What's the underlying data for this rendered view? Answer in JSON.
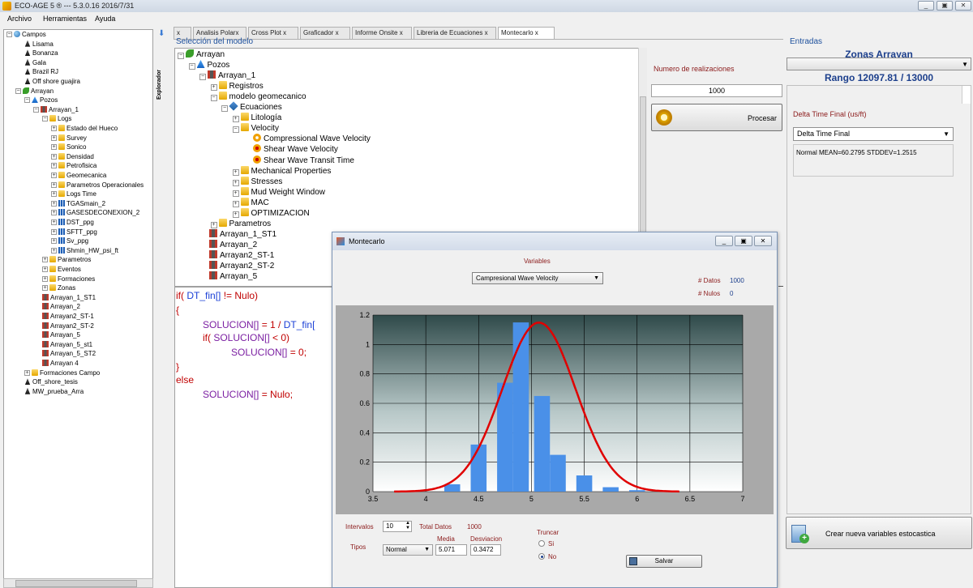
{
  "app": {
    "title": "ECO-AGE 5 ® --- 5.3.0.16     2016/7/31"
  },
  "menu": [
    "Archivo",
    "Herramientas",
    "Ayuda"
  ],
  "left_tree": [
    {
      "label": "Campos",
      "depth": 0,
      "icon": "globe",
      "toggle": "-"
    },
    {
      "label": "Lisama",
      "depth": 1,
      "icon": "rig"
    },
    {
      "label": "Bonanza",
      "depth": 1,
      "icon": "rig"
    },
    {
      "label": "Gala",
      "depth": 1,
      "icon": "rig"
    },
    {
      "label": "Brazil RJ",
      "depth": 1,
      "icon": "rig"
    },
    {
      "label": "Off shore guajira",
      "depth": 1,
      "icon": "rig"
    },
    {
      "label": "Arrayan",
      "depth": 1,
      "icon": "leaf",
      "toggle": "-"
    },
    {
      "label": "Pozos",
      "depth": 2,
      "icon": "wells",
      "toggle": "-"
    },
    {
      "label": "Arrayan_1",
      "depth": 3,
      "icon": "well",
      "toggle": "-"
    },
    {
      "label": "Logs",
      "depth": 4,
      "icon": "folder",
      "toggle": "-"
    },
    {
      "label": "Estado del Hueco",
      "depth": 5,
      "icon": "folder",
      "toggle": "+"
    },
    {
      "label": "Survey",
      "depth": 5,
      "icon": "folder",
      "toggle": "+"
    },
    {
      "label": "Sonico",
      "depth": 5,
      "icon": "folder",
      "toggle": "+"
    },
    {
      "label": "Densidad",
      "depth": 5,
      "icon": "folder",
      "toggle": "+"
    },
    {
      "label": "Petrofisica",
      "depth": 5,
      "icon": "folder",
      "toggle": "+"
    },
    {
      "label": "Geomecanica",
      "depth": 5,
      "icon": "folder",
      "toggle": "+"
    },
    {
      "label": "Parametros Operacionales",
      "depth": 5,
      "icon": "folder",
      "toggle": "+"
    },
    {
      "label": "Logs Time",
      "depth": 5,
      "icon": "folder",
      "toggle": "+"
    },
    {
      "label": "TGASmain_2",
      "depth": 5,
      "icon": "logdata",
      "toggle": "+"
    },
    {
      "label": "GASESDECONEXION_2",
      "depth": 5,
      "icon": "logdata",
      "toggle": "+"
    },
    {
      "label": "DST_ppg",
      "depth": 5,
      "icon": "logdata",
      "toggle": "+"
    },
    {
      "label": "SFTT_ppg",
      "depth": 5,
      "icon": "logdata",
      "toggle": "+"
    },
    {
      "label": "Sv_ppg",
      "depth": 5,
      "icon": "logdata",
      "toggle": "+"
    },
    {
      "label": "Shmin_HW_psi_ft",
      "depth": 5,
      "icon": "logdata",
      "toggle": "+"
    },
    {
      "label": "Parametros",
      "depth": 4,
      "icon": "folder",
      "toggle": "+"
    },
    {
      "label": "Eventos",
      "depth": 4,
      "icon": "folder",
      "toggle": "+"
    },
    {
      "label": "Formaciones",
      "depth": 4,
      "icon": "folder",
      "toggle": "+"
    },
    {
      "label": "Zonas",
      "depth": 4,
      "icon": "folder",
      "toggle": "+"
    },
    {
      "label": "Arrayan_1_ST1",
      "depth": 3,
      "icon": "well"
    },
    {
      "label": "Arrayan_2",
      "depth": 3,
      "icon": "well"
    },
    {
      "label": "Arrayan2_ST-1",
      "depth": 3,
      "icon": "well"
    },
    {
      "label": "Arrayan2_ST-2",
      "depth": 3,
      "icon": "well"
    },
    {
      "label": "Arrayan_5",
      "depth": 3,
      "icon": "well"
    },
    {
      "label": "Arrayan_5_st1",
      "depth": 3,
      "icon": "well"
    },
    {
      "label": "Arrayan_5_ST2",
      "depth": 3,
      "icon": "well"
    },
    {
      "label": "Arrayan 4",
      "depth": 3,
      "icon": "well"
    },
    {
      "label": "Formaciones Campo",
      "depth": 2,
      "icon": "folder",
      "toggle": "+"
    },
    {
      "label": "Off_shore_tesis",
      "depth": 1,
      "icon": "rig"
    },
    {
      "label": "MW_prueba_Arra",
      "depth": 1,
      "icon": "rig"
    }
  ],
  "explorer_label": "Explorador",
  "tabs": [
    {
      "label": "x"
    },
    {
      "label": "Analisis Polarx"
    },
    {
      "label": "Cross Plot x"
    },
    {
      "label": "Graficador x"
    },
    {
      "label": "Informe Onsite x"
    },
    {
      "label": "Libreria de Ecuaciones x"
    },
    {
      "label": "Montecarlo    x",
      "active": true
    }
  ],
  "selection_title": "Selección del modelo",
  "model_tree": [
    {
      "label": "Arrayan",
      "depth": 0,
      "icon": "leaf",
      "toggle": "-"
    },
    {
      "label": "Pozos",
      "depth": 1,
      "icon": "wells",
      "toggle": "-"
    },
    {
      "label": "Arrayan_1",
      "depth": 2,
      "icon": "well",
      "toggle": "-"
    },
    {
      "label": "Registros",
      "depth": 3,
      "icon": "folder",
      "toggle": "+"
    },
    {
      "label": "modelo geomecanico",
      "depth": 3,
      "icon": "folder",
      "toggle": "-"
    },
    {
      "label": "Ecuaciones",
      "depth": 4,
      "icon": "equation",
      "toggle": "-"
    },
    {
      "label": "Litología",
      "depth": 5,
      "icon": "folder",
      "toggle": "+"
    },
    {
      "label": "Velocity",
      "depth": 5,
      "icon": "folder",
      "toggle": "-"
    },
    {
      "label": "Compressional Wave Velocity",
      "depth": 6,
      "icon": "gear"
    },
    {
      "label": "Shear Wave Velocity",
      "depth": 6,
      "icon": "gearx"
    },
    {
      "label": "Shear Wave Transit Time",
      "depth": 6,
      "icon": "gearx"
    },
    {
      "label": "Mechanical Properties",
      "depth": 5,
      "icon": "folder",
      "toggle": "+"
    },
    {
      "label": "Stresses",
      "depth": 5,
      "icon": "folder",
      "toggle": "+"
    },
    {
      "label": "Mud Weight Window",
      "depth": 5,
      "icon": "folder",
      "toggle": "+"
    },
    {
      "label": "MAC",
      "depth": 5,
      "icon": "folder",
      "toggle": "+"
    },
    {
      "label": "OPTIMIZACION",
      "depth": 5,
      "icon": "folder",
      "toggle": "+"
    },
    {
      "label": "Parametros",
      "depth": 3,
      "icon": "folder",
      "toggle": "+"
    },
    {
      "label": "Arrayan_1_ST1",
      "depth": 2,
      "icon": "well"
    },
    {
      "label": "Arrayan_2",
      "depth": 2,
      "icon": "well"
    },
    {
      "label": "Arrayan2_ST-1",
      "depth": 2,
      "icon": "well"
    },
    {
      "label": "Arrayan2_ST-2",
      "depth": 2,
      "icon": "well"
    },
    {
      "label": "Arrayan_5",
      "depth": 2,
      "icon": "well"
    }
  ],
  "code_lines": [
    [
      {
        "t": "if( ",
        "c": "kw"
      },
      {
        "t": "DT_fin[]",
        "c": "vr"
      },
      {
        "t": " != Nulo)",
        "c": "kw"
      }
    ],
    [
      {
        "t": "{",
        "c": "kw"
      }
    ],
    [
      {
        "t": "SOLUCION[]",
        "c": "sol"
      },
      {
        "t": " = ",
        "c": "kw"
      },
      {
        "t": " 1 / ",
        "c": "kw"
      },
      {
        "t": " DT_fin[",
        "c": "vr"
      }
    ],
    [
      {
        "t": "if( ",
        "c": "kw"
      },
      {
        "t": "SOLUCION[]",
        "c": "sol"
      },
      {
        "t": " < 0)",
        "c": "kw"
      }
    ],
    [
      {
        "t": "SOLUCION[]",
        "c": "sol"
      },
      {
        "t": " = 0;",
        "c": "kw"
      }
    ],
    [
      {
        "t": "}",
        "c": "kw"
      }
    ],
    [
      {
        "t": "else",
        "c": "kw"
      }
    ],
    [
      {
        "t": "SOLUCION[]",
        "c": "sol"
      },
      {
        "t": " = Nulo;",
        "c": "kw"
      }
    ]
  ],
  "realizations": {
    "label": "Numero de realizaciones",
    "value": "1000"
  },
  "procesar_label": "Procesar",
  "entradas": {
    "label": "Entradas",
    "zonas_title": "Zonas Arrayan",
    "rango": "Rango 12097.81 / 13000",
    "dtf_label": "Delta Time Final (us/ft)",
    "dtf_value": "Delta Time Final",
    "distribution": "Normal MEAN=60.2795 STDDEV=1.2515"
  },
  "crear_label": "Crear nueva variables estocastica",
  "montecarlo": {
    "title": "Montecarlo",
    "variables_label": "Variables",
    "variable_selected": "Campresional Wave Velocity",
    "datos_label": "# Datos",
    "datos_value": "1000",
    "nulos_label": "# Nulos",
    "nulos_value": "0",
    "intervalos_label": "Intervalos",
    "intervalos_value": "10",
    "total_label": "Total Datos",
    "total_value": "1000",
    "tipos_label": "Tipos",
    "tipo_value": "Normal",
    "media_label": "Media",
    "media_value": "5.071",
    "desv_label": "Desviacion",
    "desv_value": "0.3472",
    "truncar_label": "Truncar",
    "si_label": "Si",
    "no_label": "No",
    "salvar_label": "Salvar"
  },
  "chart_data": {
    "type": "bar",
    "x": [
      4.0,
      4.25,
      4.5,
      4.75,
      4.9,
      5.1,
      5.25,
      5.5,
      5.75,
      6.0,
      6.25
    ],
    "values": [
      0.0,
      0.05,
      0.32,
      0.74,
      1.15,
      0.65,
      0.25,
      0.11,
      0.03,
      0.01,
      0.0
    ],
    "overlay_curve": {
      "type": "normal_pdf",
      "mean": 5.071,
      "std": 0.3472,
      "color": "#e00000",
      "x_range": [
        3.7,
        6.4
      ]
    },
    "xlim": [
      3.5,
      7
    ],
    "ylim": [
      0,
      1.2
    ],
    "xticks": [
      "3.5",
      "4",
      "4.5",
      "5",
      "5.5",
      "6",
      "6.5",
      "7"
    ],
    "yticks": [
      "0",
      "0.2",
      "0.4",
      "0.6",
      "0.8",
      "1",
      "1.2"
    ],
    "bar_color": "#4a90e8",
    "grid": true,
    "title": "",
    "xlabel": "",
    "ylabel": ""
  }
}
